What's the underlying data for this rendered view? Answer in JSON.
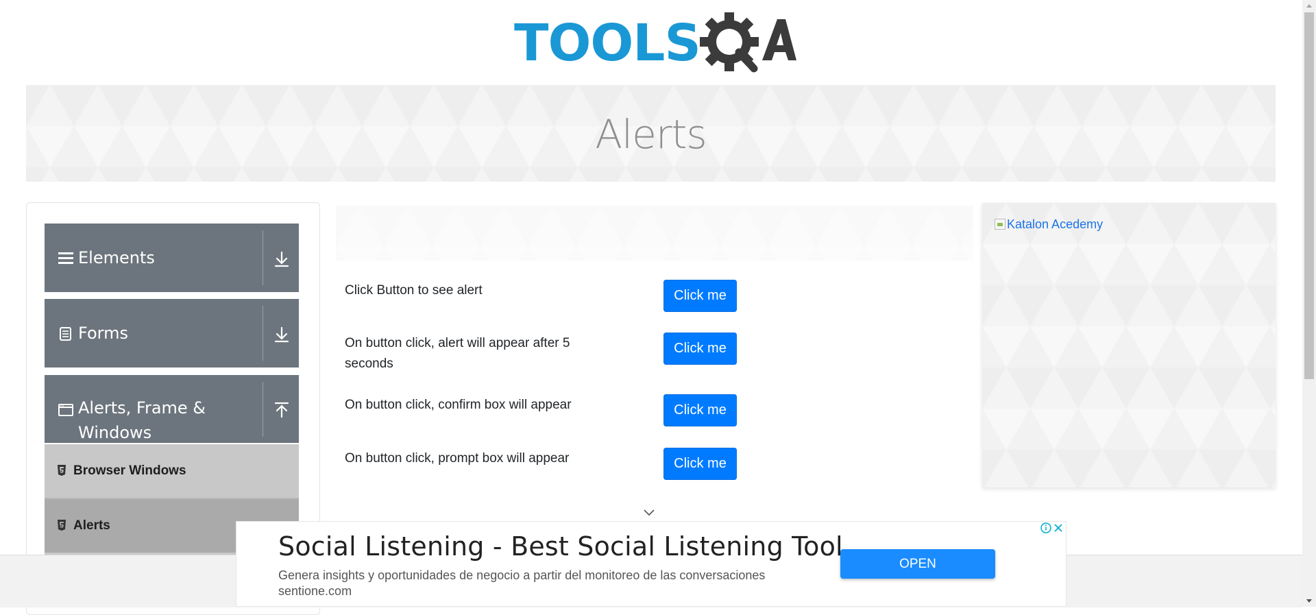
{
  "logo": {
    "text": "TOOLS",
    "suffix": "QA",
    "brand_blue": "#1a98d5",
    "brand_dark": "#3b3b3b"
  },
  "banner": {
    "title": "Alerts"
  },
  "sidebar": {
    "groups": [
      {
        "label": "Elements",
        "icon": "hamburger-icon",
        "arrow": "download-arrow-icon"
      },
      {
        "label": "Forms",
        "icon": "document-icon",
        "arrow": "download-arrow-icon"
      },
      {
        "label": "Alerts, Frame & Windows",
        "label_line1": "Alerts, Frame &",
        "label_line2": "Windows",
        "icon": "window-icon",
        "arrow": "upload-arrow-icon"
      }
    ],
    "items": [
      {
        "label": "Browser Windows",
        "icon": "html5-icon"
      },
      {
        "label": "Alerts",
        "icon": "html5-icon"
      }
    ],
    "group_color": "#6c757d",
    "item_bg": "#c8c8c8",
    "active_item_bg": "#aaaaaa"
  },
  "main": {
    "rows": [
      {
        "label": "Click Button to see alert",
        "button": "Click me"
      },
      {
        "label": "On button click, alert will appear after 5 seconds",
        "button": "Click me"
      },
      {
        "label": "On button click, confirm box will appear",
        "button": "Click me"
      },
      {
        "label": "On button click, prompt box will appear",
        "button": "Click me"
      }
    ],
    "button_color": "#007bff"
  },
  "side_ad": {
    "alt_text": "Katalon Acedemy"
  },
  "bottom_ad": {
    "headline": "Social Listening - Best Social Listening Tool",
    "description": "Genera insights y oportunidades de negocio a partir del monitoreo de las conversaciones",
    "url": "sentione.com",
    "cta": "OPEN",
    "cta_color": "#1a8cff"
  }
}
